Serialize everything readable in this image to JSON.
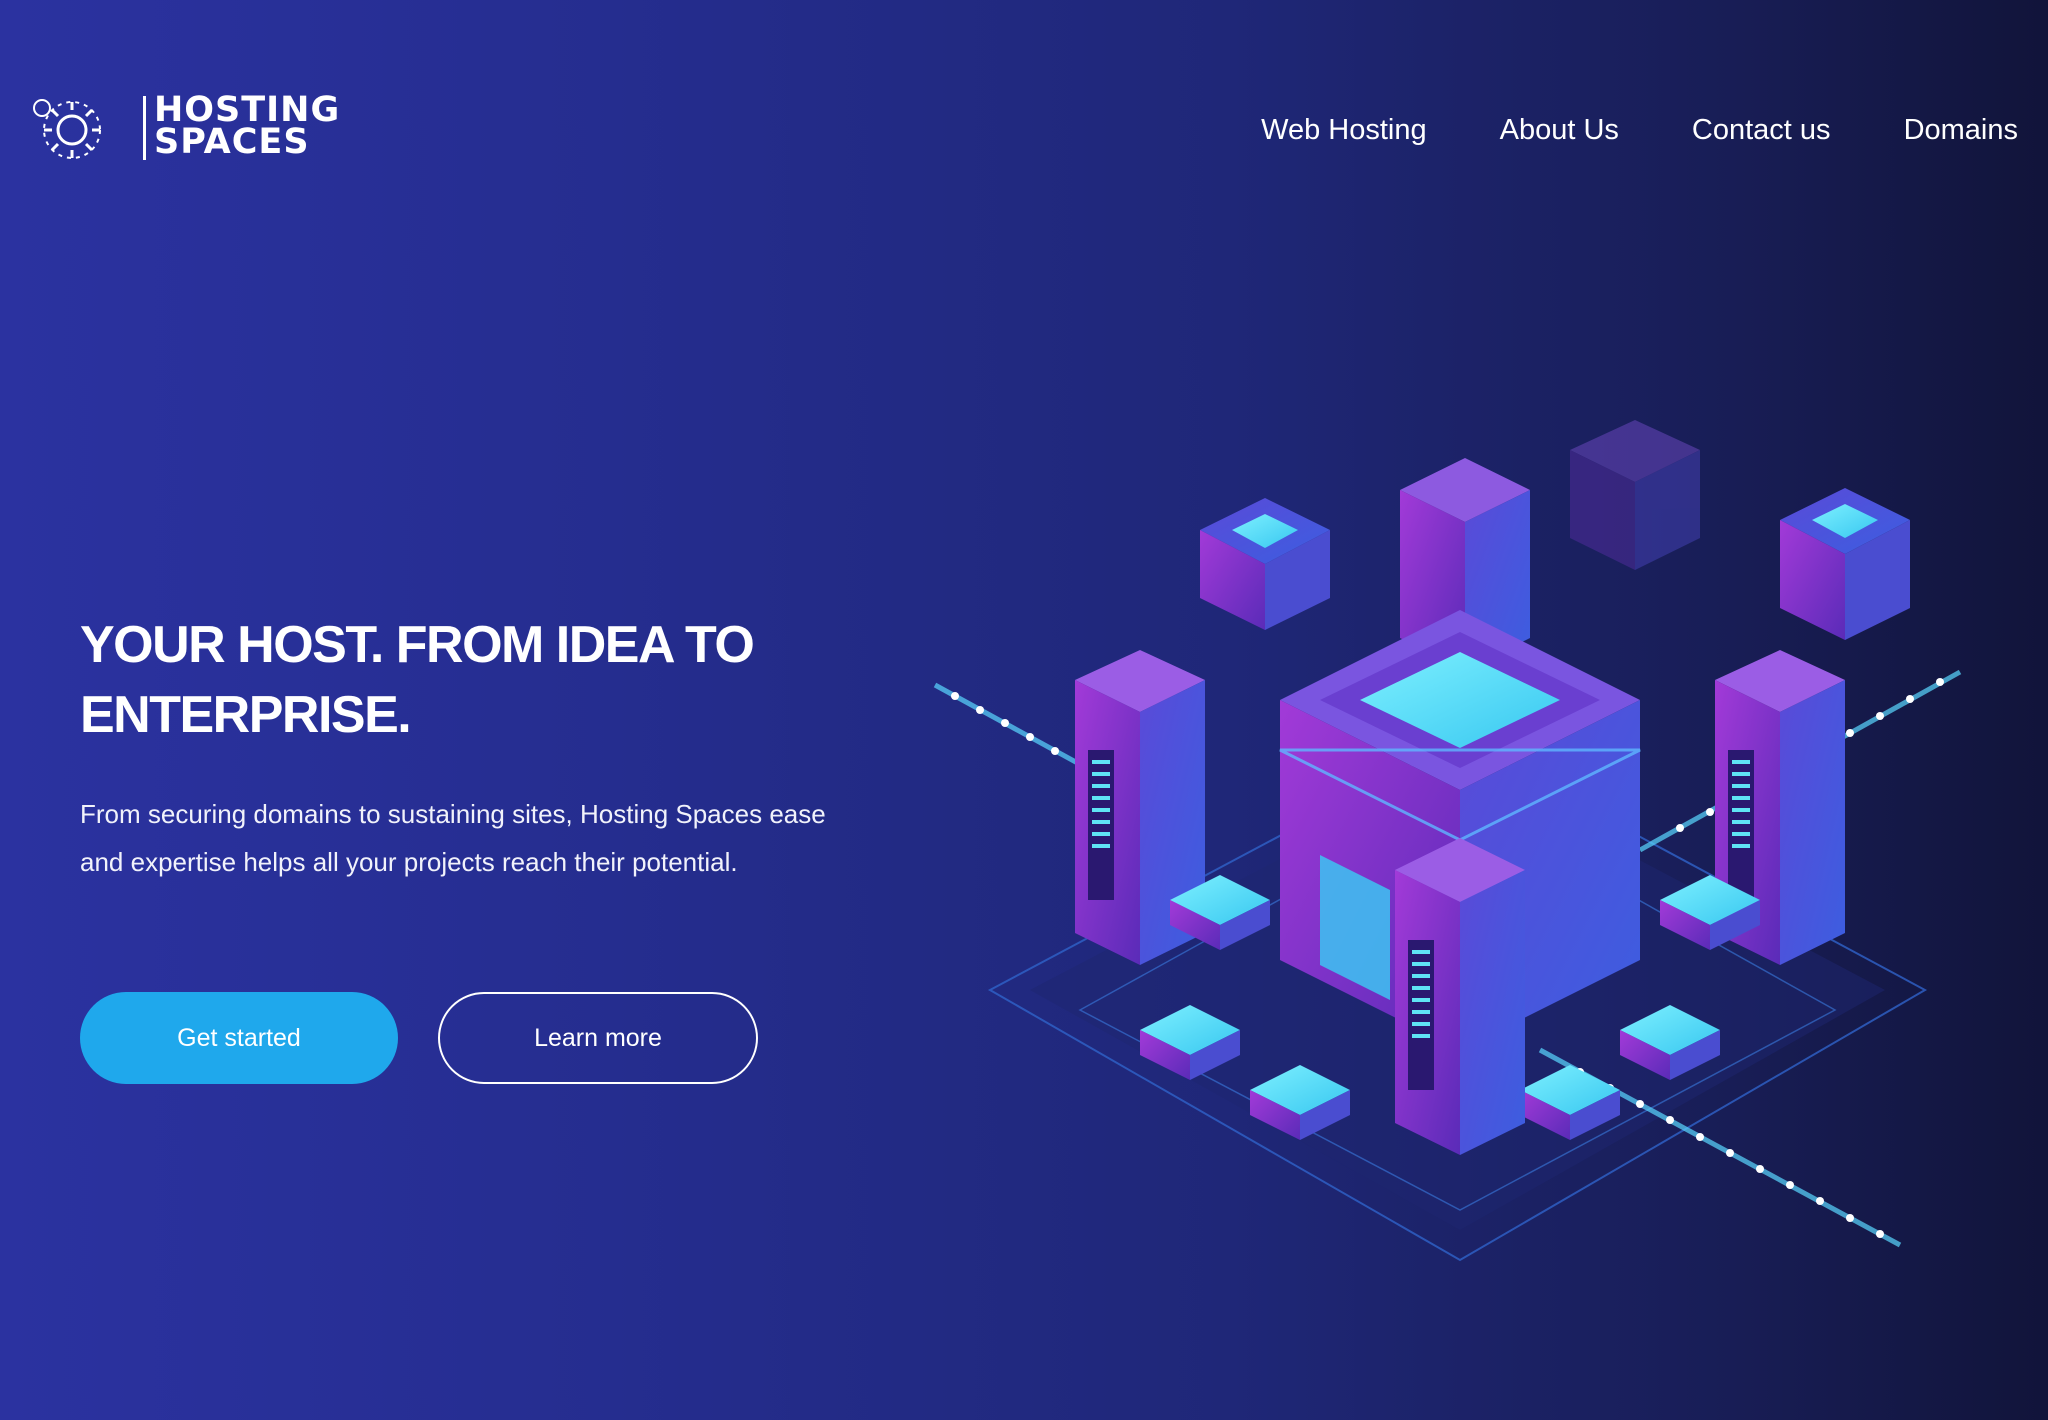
{
  "brand": {
    "logo_line1": "HOSTING",
    "logo_line2": "SPACES"
  },
  "nav": {
    "items": [
      "Web Hosting",
      "About Us",
      "Contact us",
      "Domains"
    ]
  },
  "hero": {
    "title_line1": "YOUR HOST. FROM IDEA TO",
    "title_line2": "ENTERPRISE.",
    "description": "From securing domains to sustaining sites, Hosting Spaces ease and expertise helps all your projects reach their potential.",
    "primary_button": "Get started",
    "secondary_button": "Learn more"
  },
  "colors": {
    "background_left": "#2b32a0",
    "background_right": "#11143a",
    "accent": "#1fa8ec",
    "server_purple": "#8a3fd6",
    "server_cyan": "#5fe3f5"
  }
}
